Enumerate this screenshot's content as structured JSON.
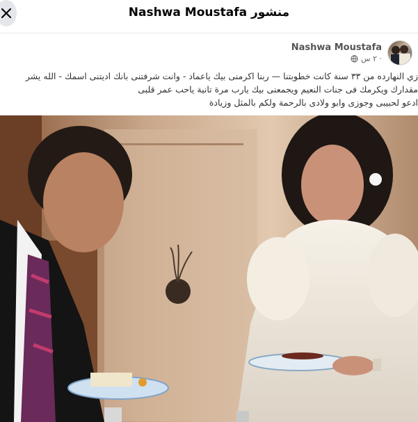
{
  "header": {
    "title": "منشور Nashwa Moustafa",
    "close_icon": "close-icon"
  },
  "post": {
    "author": "Nashwa Moustafa",
    "time": "٢ س ·",
    "privacy_icon": "globe-icon",
    "text_lines": [
      "زي النهارده من ٣٣ سنة كانت خطوبتنا — ربنا اكرمنى بيك ياعماد - وانت شرفتنى بانك اديتنى اسمك - الله يشر",
      "مقدارك ويكرمك فى جنات النعيم ويجمعنى بيك يارب مرة تانية ياحب عمر قلبى",
      "ادعو لحبيبى وجوزى وابو ولادى بالرحمة ولكم بالمثل وزيادة"
    ]
  },
  "photo": {
    "subject": "engagement-photo"
  }
}
